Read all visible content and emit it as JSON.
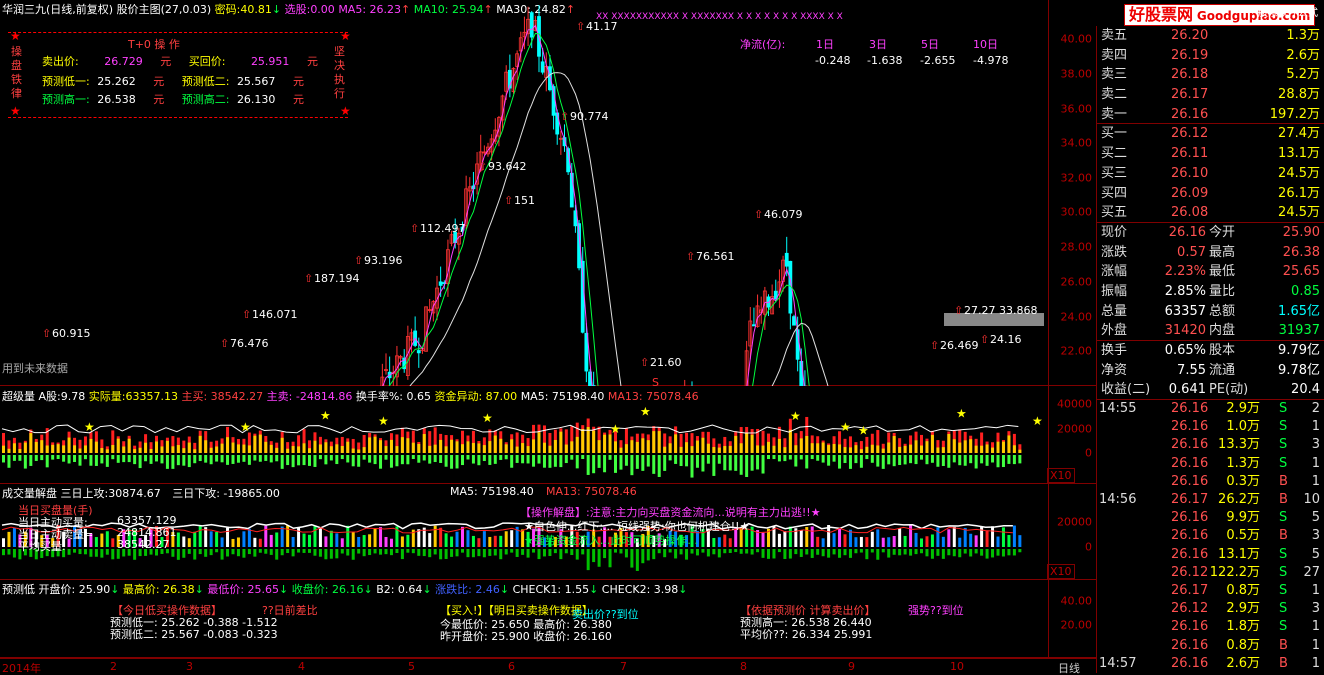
{
  "main_header": {
    "stock": "华润三九(日线,前复权) 股价主图(27,0.03)",
    "pwd_label": "密码:",
    "pwd_value": "40.81",
    "arrow": "↓",
    "select_label": "选股:",
    "select_value": "0.00",
    "ma5": "MA5: 26.23",
    "ma5_arrow": "↑",
    "ma10": "MA10: 25.94",
    "ma10_arrow": "↑",
    "ma30": "MA30: 24.82",
    "ma30_arrow": "↑"
  },
  "xx_marks": "XX    XXXXXXXXXXX        X         XXXXXXX X  X  X X X X  X     XXXX          X      X",
  "op_box": {
    "title": "T+0  操  作",
    "side_left": "操盘铁律",
    "side_right": "坚决执行",
    "sell_label": "卖出价:",
    "sell_value": "26.729",
    "buy_back_label": "买回价:",
    "buy_back_value": "25.951",
    "yuan": "元",
    "low1_label": "预测低一:",
    "low1_value": "25.262",
    "low2_label": "预测低二:",
    "low2_value": "25.567",
    "high1_label": "预测高一:",
    "high1_value": "26.538",
    "high2_label": "预测高二:",
    "high2_value": "26.130"
  },
  "net_flow": {
    "label": "净流(亿):",
    "periods": [
      "1日",
      "3日",
      "5日",
      "10日"
    ],
    "values": [
      "-0.248",
      "-1.638",
      "-2.655",
      "-4.978"
    ]
  },
  "price_axis": [
    "40.00",
    "38.00",
    "36.00",
    "34.00",
    "32.00",
    "30.00",
    "28.00",
    "26.00",
    "24.00",
    "22.00"
  ],
  "annotations": [
    {
      "t": "41.17"
    },
    {
      "t": "90.774"
    },
    {
      "t": "93.642"
    },
    {
      "t": "151"
    },
    {
      "t": "112.497"
    },
    {
      "t": "93.196"
    },
    {
      "t": "187.194"
    },
    {
      "t": "146.071"
    },
    {
      "t": "76.476"
    },
    {
      "t": "60.915"
    },
    {
      "t": "46.079"
    },
    {
      "t": "76.561"
    },
    {
      "t": "21.60"
    },
    {
      "t": "27.27 33.868"
    },
    {
      "t": "26.469"
    },
    {
      "t": "24.16"
    },
    {
      "t": "S"
    }
  ],
  "future_text": "用到未来数据",
  "vol_header": {
    "name": "超级量",
    "a_label": "A股:",
    "a_value": "9.78",
    "real_label": "实际量:",
    "real_value": "63357.13",
    "main_buy": "主买: 38542.27",
    "main_sell": "主卖: -24814.86",
    "turnover": "换手率%: 0.65",
    "fund": "资金异动: 87.00",
    "ma5": "MA5: 75198.40",
    "ma13": "MA13: 75078.46"
  },
  "vol_axis": [
    "40000",
    "20000",
    "0"
  ],
  "x10": "X10",
  "ind_header": {
    "name": "成交量解盘",
    "up_label": "三日上攻:",
    "up_value": "30874.67",
    "up2": "三日下攻: -19865.00",
    "ma5": "MA5: 75198.40",
    "ma13": "MA13: 75078.46"
  },
  "ind_axis": [
    "20000",
    "0"
  ],
  "ind_text": {
    "l1": "当日买盘量(手)",
    "l2": "当日主动买量:",
    "l2v": "63357.129",
    "l3": "当日主动卖量=",
    "l3v": "24814.861",
    "l4": "平均买量:",
    "l4v": "38542.27",
    "s1": "【操作解盘】:注意:主力向买盘资金流向...说明有主力出逃!!★",
    "s2": "★白色伸...红下:... 短线强势:你也何机建仓!!★",
    "s3": "★强势资金流入...此时可顺势操作..."
  },
  "pred_header": {
    "name": "预测低",
    "open": "开盘价: 25.90",
    "high": "最高价: 26.38",
    "low": "最低价: 25.65",
    "close": "收盘价: 26.16",
    "b2": "B2: 0.64",
    "ratio": "涨跌比: 2.46",
    "check1": "CHECK1: 1.55",
    "check2": "CHECK2: 3.98"
  },
  "pred_axis": [
    "40.00",
    "20.00"
  ],
  "pred_text": {
    "t1": "【今日低买操作数据】",
    "t1b": "??日前差比",
    "r1": "预测低一:  25.262 -0.388  -1.512",
    "r2": "预测低二:  25.567 -0.083  -0.323",
    "t2": "【买入!】【明日买卖操作数据】",
    "t2b": "卖出价??到位",
    "r3": "今最低价: 25.650  最高价: 26.380",
    "r4": "昨开盘价: 25.900  收盘价: 26.160",
    "t3": "【依据预测价 计算卖出价】",
    "t3b": "强势??到位",
    "r5": "预测高一:  26.538  26.440",
    "r6": "平均价??:  26.334  25.991"
  },
  "date_axis": {
    "year": "2014年",
    "months": [
      "2",
      "3",
      "4",
      "5",
      "6",
      "7",
      "8",
      "9",
      "10"
    ],
    "period": "日线"
  },
  "logo": {
    "brand": "好股票网",
    "domain": "Goodgupiao.com",
    "sub": "股票软件公式"
  },
  "order_book": [
    {
      "l": "卖五",
      "p": "26.20",
      "v": "1.3万"
    },
    {
      "l": "卖四",
      "p": "26.19",
      "v": "2.6万"
    },
    {
      "l": "卖三",
      "p": "26.18",
      "v": "5.2万"
    },
    {
      "l": "卖二",
      "p": "26.17",
      "v": "28.8万"
    },
    {
      "l": "卖一",
      "p": "26.16",
      "v": "197.2万"
    },
    {
      "l": "买一",
      "p": "26.12",
      "v": "27.4万"
    },
    {
      "l": "买二",
      "p": "26.11",
      "v": "13.1万"
    },
    {
      "l": "买三",
      "p": "26.10",
      "v": "24.5万"
    },
    {
      "l": "买四",
      "p": "26.09",
      "v": "26.1万"
    },
    {
      "l": "买五",
      "p": "26.08",
      "v": "24.5万"
    }
  ],
  "quote": [
    {
      "a": "现价",
      "av": "26.16",
      "b": "今开",
      "bv": "25.90"
    },
    {
      "a": "涨跌",
      "av": "0.57",
      "b": "最高",
      "bv": "26.38"
    },
    {
      "a": "涨幅",
      "av": "2.23%",
      "b": "最低",
      "bv": "25.65"
    },
    {
      "a": "振幅",
      "av": "2.85%",
      "b": "量比",
      "bv": "0.85"
    },
    {
      "a": "总量",
      "av": "63357",
      "b": "总额",
      "bv": "1.65亿"
    },
    {
      "a": "外盘",
      "av": "31420",
      "b": "内盘",
      "bv": "31937"
    }
  ],
  "quote2": [
    {
      "a": "换手",
      "av": "0.65%",
      "b": "股本",
      "bv": "9.79亿"
    },
    {
      "a": "净资",
      "av": "7.55",
      "b": "流通",
      "bv": "9.78亿"
    },
    {
      "a": "收益(二)",
      "av": "0.641",
      "b": "PE(动)",
      "bv": "20.4"
    }
  ],
  "ticks": [
    {
      "t": "14:55",
      "p": "26.16",
      "v": "2.9万",
      "s": "S",
      "n": "2"
    },
    {
      "t": "",
      "p": "26.16",
      "v": "1.0万",
      "s": "S",
      "n": "1"
    },
    {
      "t": "",
      "p": "26.16",
      "v": "13.3万",
      "s": "S",
      "n": "3"
    },
    {
      "t": "",
      "p": "26.16",
      "v": "1.3万",
      "s": "S",
      "n": "1"
    },
    {
      "t": "",
      "p": "26.16",
      "v": "0.3万",
      "s": "B",
      "n": "1"
    },
    {
      "t": "14:56",
      "p": "26.17",
      "v": "26.2万",
      "s": "B",
      "n": "10"
    },
    {
      "t": "",
      "p": "26.16",
      "v": "9.9万",
      "s": "S",
      "n": "5"
    },
    {
      "t": "",
      "p": "26.16",
      "v": "0.5万",
      "s": "B",
      "n": "3"
    },
    {
      "t": "",
      "p": "26.16",
      "v": "13.1万",
      "s": "S",
      "n": "5"
    },
    {
      "t": "",
      "p": "26.12",
      "v": "122.2万",
      "s": "S",
      "n": "27"
    },
    {
      "t": "",
      "p": "26.17",
      "v": "0.8万",
      "s": "S",
      "n": "1"
    },
    {
      "t": "",
      "p": "26.12",
      "v": "2.9万",
      "s": "S",
      "n": "3"
    },
    {
      "t": "",
      "p": "26.16",
      "v": "1.8万",
      "s": "S",
      "n": "1"
    },
    {
      "t": "",
      "p": "26.16",
      "v": "0.8万",
      "s": "B",
      "n": "1"
    },
    {
      "t": "14:57",
      "p": "26.16",
      "v": "2.6万",
      "s": "B",
      "n": "1"
    }
  ]
}
